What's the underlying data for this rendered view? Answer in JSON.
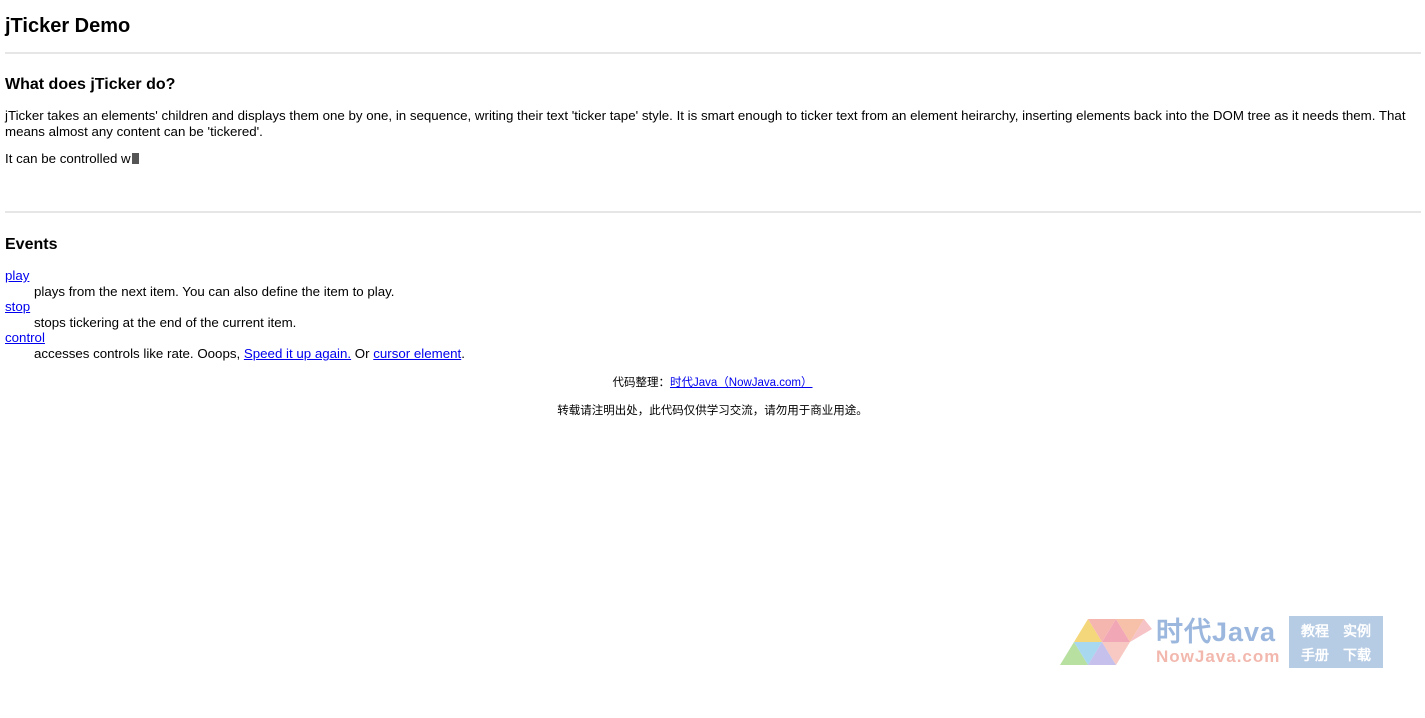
{
  "page": {
    "title": "jTicker Demo"
  },
  "what": {
    "heading": "What does jTicker do?",
    "intro": "jTicker takes an elements' children and displays them one by one, in sequence, writing their text 'ticker tape' style. It is smart enough to ticker text from an element heirarchy, inserting elements back into the DOM tree as it needs them. That means almost any content can be 'tickered'.",
    "ticker_text": "It can be controlled w"
  },
  "events": {
    "heading": "Events",
    "items": [
      {
        "term": "play",
        "desc": "plays from the next item. You can also define the item to play."
      },
      {
        "term": "stop",
        "desc": "stops tickering at the end of the current item."
      },
      {
        "term": "control",
        "desc_before": "accesses controls like rate. Ooops, ",
        "link_speed": "Speed it up again.",
        "desc_mid": " Or ",
        "link_cursor": "cursor element",
        "desc_after": "."
      }
    ]
  },
  "footer": {
    "credit_label": "代码整理：",
    "credit_link": "时代Java（NowJava.com）",
    "notice": "转载请注明出处，此代码仅供学习交流，请勿用于商业用途。"
  },
  "watermark": {
    "title": "时代Java",
    "site": "NowJava.com",
    "cells": [
      "教程",
      "实例",
      "手册",
      "下载"
    ]
  },
  "colors": {
    "link": "#0000ee",
    "rule": "#e6e6e6",
    "cursor": "#555555"
  }
}
